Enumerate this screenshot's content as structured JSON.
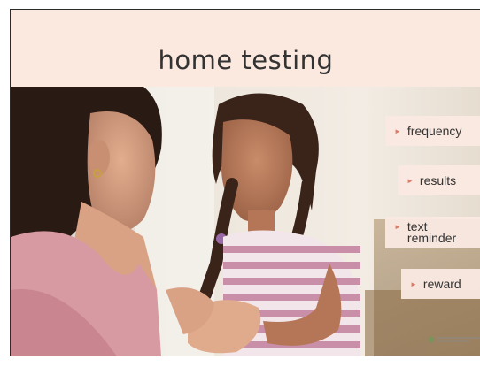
{
  "slide": {
    "title": "home testing",
    "bullets": [
      {
        "label": "frequency"
      },
      {
        "label": "results"
      },
      {
        "label": "text reminder"
      },
      {
        "label": "reward"
      }
    ]
  },
  "colors": {
    "header_bg": "#fbe8df",
    "title_text": "#333333",
    "bullet_bg": "#fae9e1",
    "bullet_arrow": "#e07a66"
  }
}
